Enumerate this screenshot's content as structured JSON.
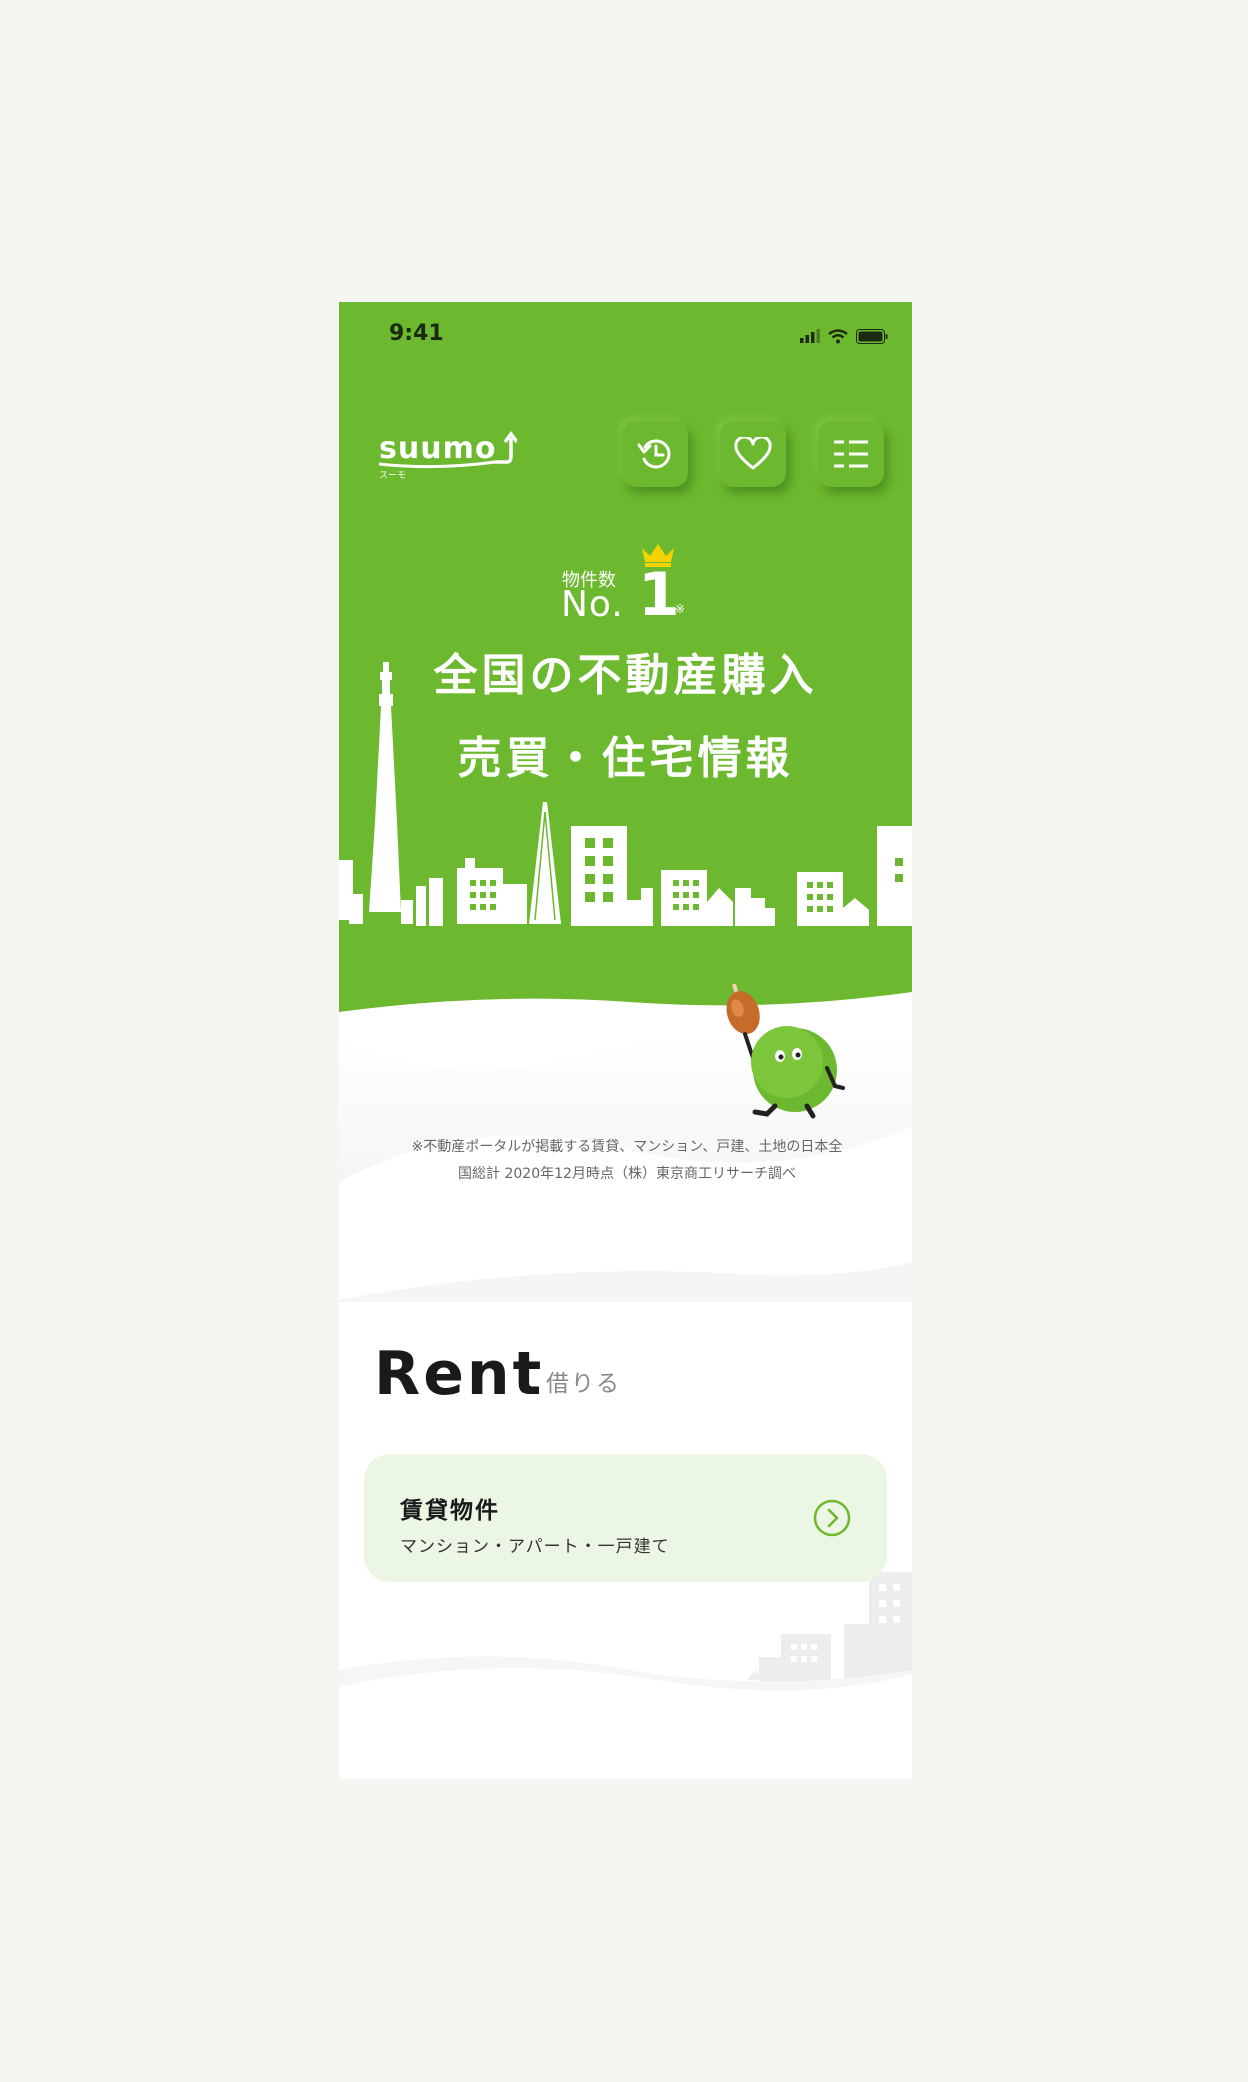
{
  "status": {
    "time": "9:41"
  },
  "brand": {
    "logo_text": "suumo",
    "logo_sub": "スーモ"
  },
  "header": {
    "history_icon": "history-icon",
    "favorite_icon": "heart-icon",
    "menu_icon": "menu-list-icon"
  },
  "hero": {
    "badge_label": "物件数",
    "badge_no": "No.",
    "badge_rank": "1",
    "badge_note_mark": "※",
    "headline_line1": "全国の不動産購入",
    "headline_line2": "売買・住宅情報",
    "footnote_line1": "※不動産ポータルが掲載する賃貸、マンション、戸建、土地の日本全",
    "footnote_line2": "国総計 2020年12月時点（株）東京商工リサーチ調べ",
    "colors": {
      "brand_green": "#6cb92f",
      "crown": "#f5d300"
    }
  },
  "rent": {
    "title": "Rent",
    "subtitle": "借りる",
    "card": {
      "title": "賃貸物件",
      "subtitle": "マンション・アパート・一戸建て",
      "arrow_icon": "chevron-right-circle-icon"
    }
  }
}
